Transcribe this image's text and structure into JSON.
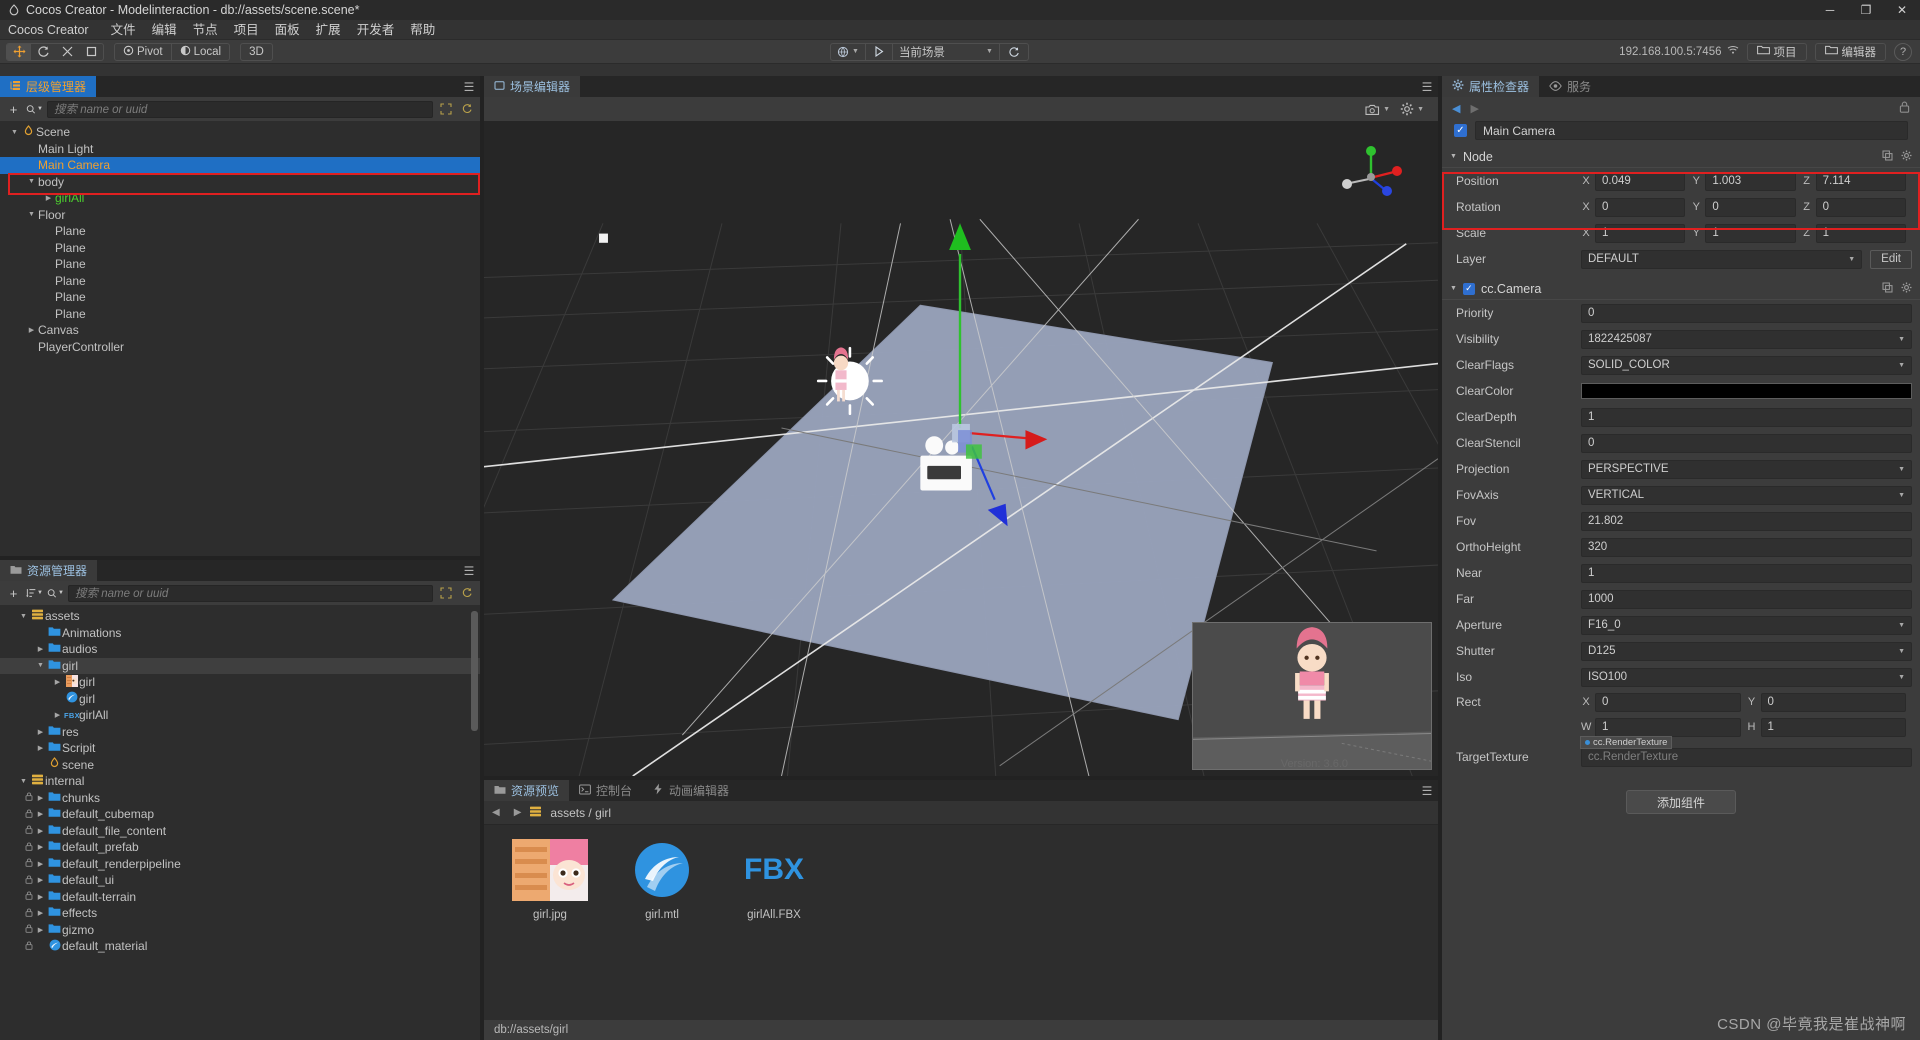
{
  "window": {
    "title": "Cocos Creator - Modelinteraction - db://assets/scene.scene*",
    "minimize": "─",
    "maximize": "❐",
    "close": "✕"
  },
  "menubar": {
    "brand": "Cocos Creator",
    "items": [
      "文件",
      "编辑",
      "节点",
      "项目",
      "面板",
      "扩展",
      "开发者",
      "帮助"
    ]
  },
  "toolbar": {
    "transform_tools": [
      "move-tool",
      "rotate-tool",
      "scale-tool",
      "rect-tool"
    ],
    "pivot_label": "Pivot",
    "coord_label": "Local",
    "dimension_label": "3D",
    "preview_device": "globe-icon",
    "play_label": "play-icon",
    "scene_select": "当前场景",
    "refresh_label": "refresh-icon",
    "ip_address": "192.168.100.5:7456",
    "project_button": "项目",
    "editor_button": "编辑器",
    "help_button": "?"
  },
  "hierarchy": {
    "tab_label": "层级管理器",
    "search_placeholder": "搜索 name or uuid",
    "add_label": "+",
    "nodes": [
      {
        "label": "Scene",
        "depth": 0,
        "arrow": "down",
        "icon": "scene-icon",
        "selected": false
      },
      {
        "label": "Main Light",
        "depth": 1,
        "arrow": "",
        "icon": "",
        "selected": false
      },
      {
        "label": "Main Camera",
        "depth": 1,
        "arrow": "",
        "icon": "",
        "selected": true
      },
      {
        "label": "body",
        "depth": 1,
        "arrow": "down",
        "icon": "",
        "selected": false
      },
      {
        "label": "girlAll",
        "depth": 2,
        "arrow": "right",
        "icon": "",
        "selected": false,
        "green": true
      },
      {
        "label": "Floor",
        "depth": 1,
        "arrow": "down",
        "icon": "",
        "selected": false
      },
      {
        "label": "Plane",
        "depth": 2,
        "arrow": "",
        "icon": "",
        "selected": false
      },
      {
        "label": "Plane",
        "depth": 2,
        "arrow": "",
        "icon": "",
        "selected": false
      },
      {
        "label": "Plane",
        "depth": 2,
        "arrow": "",
        "icon": "",
        "selected": false
      },
      {
        "label": "Plane",
        "depth": 2,
        "arrow": "",
        "icon": "",
        "selected": false
      },
      {
        "label": "Plane",
        "depth": 2,
        "arrow": "",
        "icon": "",
        "selected": false
      },
      {
        "label": "Plane",
        "depth": 2,
        "arrow": "",
        "icon": "",
        "selected": false
      },
      {
        "label": "Canvas",
        "depth": 1,
        "arrow": "right",
        "icon": "",
        "selected": false
      },
      {
        "label": "PlayerController",
        "depth": 1,
        "arrow": "",
        "icon": "",
        "selected": false
      }
    ]
  },
  "assets": {
    "tab_label": "资源管理器",
    "search_placeholder": "搜索 name or uuid",
    "nodes": [
      {
        "label": "assets",
        "depth": 0,
        "arrow": "down",
        "icon": "db-icon",
        "locked": false
      },
      {
        "label": "Animations",
        "depth": 1,
        "arrow": "",
        "icon": "folder-icon",
        "locked": false
      },
      {
        "label": "audios",
        "depth": 1,
        "arrow": "right",
        "icon": "folder-icon",
        "locked": false
      },
      {
        "label": "girl",
        "depth": 1,
        "arrow": "down",
        "icon": "folder-icon",
        "locked": false,
        "highlight": true
      },
      {
        "label": "girl",
        "depth": 2,
        "arrow": "right",
        "icon": "image-icon",
        "locked": false
      },
      {
        "label": "girl",
        "depth": 2,
        "arrow": "",
        "icon": "material-icon",
        "locked": false
      },
      {
        "label": "girlAll",
        "depth": 2,
        "arrow": "right",
        "icon": "fbx-icon",
        "locked": false
      },
      {
        "label": "res",
        "depth": 1,
        "arrow": "right",
        "icon": "folder-icon",
        "locked": false
      },
      {
        "label": "Scripit",
        "depth": 1,
        "arrow": "right",
        "icon": "folder-icon",
        "locked": false
      },
      {
        "label": "scene",
        "depth": 1,
        "arrow": "",
        "icon": "scene-icon",
        "locked": false
      },
      {
        "label": "internal",
        "depth": 0,
        "arrow": "down",
        "icon": "db-icon",
        "locked": false
      },
      {
        "label": "chunks",
        "depth": 1,
        "arrow": "right",
        "icon": "folder-icon",
        "locked": true
      },
      {
        "label": "default_cubemap",
        "depth": 1,
        "arrow": "right",
        "icon": "folder-icon",
        "locked": true
      },
      {
        "label": "default_file_content",
        "depth": 1,
        "arrow": "right",
        "icon": "folder-icon",
        "locked": true
      },
      {
        "label": "default_prefab",
        "depth": 1,
        "arrow": "right",
        "icon": "folder-icon",
        "locked": true
      },
      {
        "label": "default_renderpipeline",
        "depth": 1,
        "arrow": "right",
        "icon": "folder-icon",
        "locked": true
      },
      {
        "label": "default_ui",
        "depth": 1,
        "arrow": "right",
        "icon": "folder-icon",
        "locked": true
      },
      {
        "label": "default-terrain",
        "depth": 1,
        "arrow": "right",
        "icon": "folder-icon",
        "locked": true
      },
      {
        "label": "effects",
        "depth": 1,
        "arrow": "right",
        "icon": "folder-icon",
        "locked": true
      },
      {
        "label": "gizmo",
        "depth": 1,
        "arrow": "right",
        "icon": "folder-icon",
        "locked": true
      },
      {
        "label": "default_material",
        "depth": 1,
        "arrow": "",
        "icon": "material-icon",
        "locked": true
      }
    ]
  },
  "scene": {
    "tab_label": "场景编辑器",
    "camera_icon": "camera-gizmo-icon",
    "gear_icon": "gear-icon",
    "menu_icon": "hamburger-icon",
    "version_watermark": "Version: 3.6.0"
  },
  "bottom": {
    "tabs": [
      {
        "label": "资源预览",
        "icon": "folder-icon",
        "active": true
      },
      {
        "label": "控制台",
        "icon": "terminal-icon",
        "active": false
      },
      {
        "label": "动画编辑器",
        "icon": "anim-icon",
        "active": false
      }
    ],
    "breadcrumb": "assets / girl",
    "breadcrumb_icon": "db-icon",
    "back_icon": "back-arrow-icon",
    "forward_icon": "forward-arrow-icon",
    "items": [
      {
        "name": "girl.jpg",
        "type": "image"
      },
      {
        "name": "girl.mtl",
        "type": "material"
      },
      {
        "name": "girlAll.FBX",
        "type": "fbx"
      }
    ],
    "status": "db://assets/girl"
  },
  "inspector": {
    "tabs": [
      {
        "label": "属性检查器",
        "icon": "gear-icon",
        "active": true
      },
      {
        "label": "服务",
        "icon": "service-icon",
        "active": false
      }
    ],
    "node_name": "Main Camera",
    "node_enabled": true,
    "node_section": {
      "title": "Node",
      "position_label": "Position",
      "position": {
        "x": "0.049",
        "y": "1.003",
        "z": "7.114"
      },
      "rotation_label": "Rotation",
      "rotation": {
        "x": "0",
        "y": "0",
        "z": "0"
      },
      "scale_label": "Scale",
      "scale": {
        "x": "1",
        "y": "1",
        "z": "1"
      },
      "layer_label": "Layer",
      "layer_value": "DEFAULT",
      "layer_edit": "Edit"
    },
    "camera_section": {
      "title": "cc.Camera",
      "enabled": true,
      "fields": [
        {
          "label": "Priority",
          "value": "0",
          "kind": "text"
        },
        {
          "label": "Visibility",
          "value": "1822425087",
          "kind": "select"
        },
        {
          "label": "ClearFlags",
          "value": "SOLID_COLOR",
          "kind": "select"
        },
        {
          "label": "ClearColor",
          "value": "",
          "kind": "color"
        },
        {
          "label": "ClearDepth",
          "value": "1",
          "kind": "text"
        },
        {
          "label": "ClearStencil",
          "value": "0",
          "kind": "text"
        },
        {
          "label": "Projection",
          "value": "PERSPECTIVE",
          "kind": "select"
        },
        {
          "label": "FovAxis",
          "value": "VERTICAL",
          "kind": "select"
        },
        {
          "label": "Fov",
          "value": "21.802",
          "kind": "text"
        },
        {
          "label": "OrthoHeight",
          "value": "320",
          "kind": "text"
        },
        {
          "label": "Near",
          "value": "1",
          "kind": "text"
        },
        {
          "label": "Far",
          "value": "1000",
          "kind": "text"
        },
        {
          "label": "Aperture",
          "value": "F16_0",
          "kind": "select"
        },
        {
          "label": "Shutter",
          "value": "D125",
          "kind": "select"
        },
        {
          "label": "Iso",
          "value": "ISO100",
          "kind": "select"
        }
      ],
      "rect_label": "Rect",
      "rect": {
        "x_label": "X",
        "x": "0",
        "y_label": "Y",
        "y": "0",
        "w_label": "W",
        "w": "1",
        "h_label": "H",
        "h": "1"
      },
      "target_texture_label": "TargetTexture",
      "target_texture_value": "cc.RenderTexture",
      "target_texture_tag": "cc.RenderTexture"
    },
    "add_component": "添加组件"
  },
  "watermark": "CSDN @毕竟我是崔战神啊",
  "colors": {
    "accent_blue": "#1f6fc4",
    "accent_orange": "#f0a030",
    "highlight_red": "#e02020",
    "tree_green": "#4ccf2f"
  }
}
